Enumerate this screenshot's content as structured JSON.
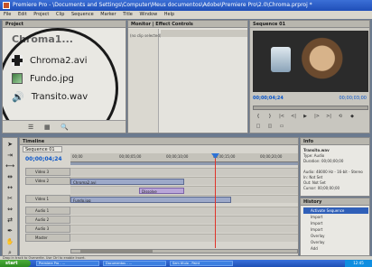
{
  "window": {
    "title": "Premiere Pro - \\Documents and Settings\\Computer\\Meus documentos\\Adobe\\Premiere Pro\\2.0\\Chroma.prproj *"
  },
  "menu": [
    "File",
    "Edit",
    "Project",
    "Clip",
    "Sequence",
    "Marker",
    "Title",
    "Window",
    "Help"
  ],
  "project": {
    "tab": "Project",
    "header_partial": "Chroma1...",
    "items": [
      {
        "label": "Chroma2.avi",
        "icon": "film-icon"
      },
      {
        "label": "Fundo.jpg",
        "icon": "image-icon"
      },
      {
        "label": "Transito.wav",
        "icon": "audio-icon"
      }
    ]
  },
  "effects": {
    "tabs": "Monitor | Effect Controls",
    "note": "(no clip selected)"
  },
  "monitor": {
    "tab": "Sequence 01",
    "timecode_left": "00;00;04;24",
    "timecode_right": "00;00;03;00",
    "transport": [
      "{",
      "}",
      "|<",
      "<|",
      "▶",
      "|>",
      ">|",
      "⟲",
      "◆",
      "□",
      "◫",
      "▭"
    ]
  },
  "timeline": {
    "tab": "Timeline",
    "subtab": "Sequence 01",
    "timecode": "00;00;04;24",
    "ruler": [
      "00;00",
      "00;00;05;00",
      "00;00;10;00",
      "00;00;15;00",
      "00;00;20;00"
    ],
    "tracks": [
      {
        "name": "Video 3"
      },
      {
        "name": "Video 2"
      },
      {
        "name": "Video 1"
      },
      {
        "name": "Audio 1"
      },
      {
        "name": "Audio 2"
      },
      {
        "name": "Audio 3"
      },
      {
        "name": "Master"
      }
    ],
    "clips": {
      "v2": "Chroma2.avi",
      "v1": "Fundo.jpg",
      "trans": "Dissolve"
    }
  },
  "info": {
    "tab": "Info",
    "lines": [
      "Transito.wav",
      "Type: Audio",
      "Duration: 00;00;00;00",
      "",
      "Audio: 48000 Hz - 16-bit - Stereo",
      "In: Not Set",
      "Out: Not Set",
      "Cursor: 00;00;00;00"
    ]
  },
  "history": {
    "tab": "History",
    "items": [
      "Activate Sequence",
      "Import",
      "Import",
      "Import",
      "Overlay",
      "Overlay",
      "Add"
    ]
  },
  "status": {
    "text": "Drop in track to Overwrite. Use Ctrl to enable Insert."
  },
  "taskbar": {
    "start": "start",
    "tasks": [
      "Premiere Pro - ...",
      "Documentos - ...",
      "Sem título - Paint"
    ],
    "tray": "12:45"
  }
}
